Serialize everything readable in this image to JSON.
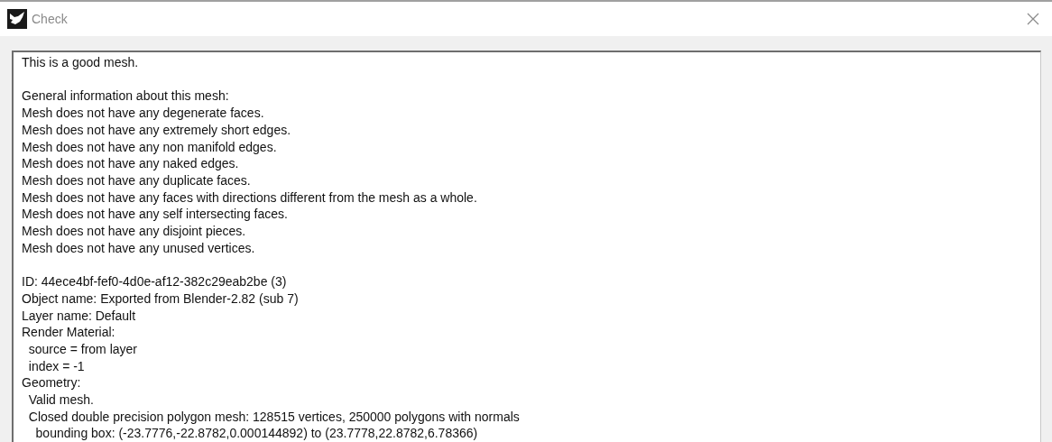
{
  "window": {
    "title": "Check"
  },
  "report": {
    "paragraphs": [
      [
        "This is a good mesh."
      ],
      [
        "General information about this mesh:",
        "Mesh does not have any degenerate faces.",
        "Mesh does not have any extremely short edges.",
        "Mesh does not have any non manifold edges.",
        "Mesh does not have any naked edges.",
        "Mesh does not have any duplicate faces.",
        "Mesh does not have any faces with directions different from the mesh as a whole.",
        "Mesh does not have any self intersecting faces.",
        "Mesh does not have any disjoint pieces.",
        "Mesh does not have any unused vertices."
      ],
      [
        "ID: 44ece4bf-fef0-4d0e-af12-382c29eab2be (3)",
        "Object name: Exported from Blender-2.82 (sub 7)",
        "Layer name: Default",
        "Render Material:",
        "  source = from layer",
        "  index = -1",
        "Geometry:",
        "  Valid mesh.",
        "  Closed double precision polygon mesh: 128515 vertices, 250000 polygons with normals",
        "    bounding box: (-23.7776,-22.8782,0.000144892) to (23.7778,22.8782,6.78366)"
      ]
    ]
  }
}
